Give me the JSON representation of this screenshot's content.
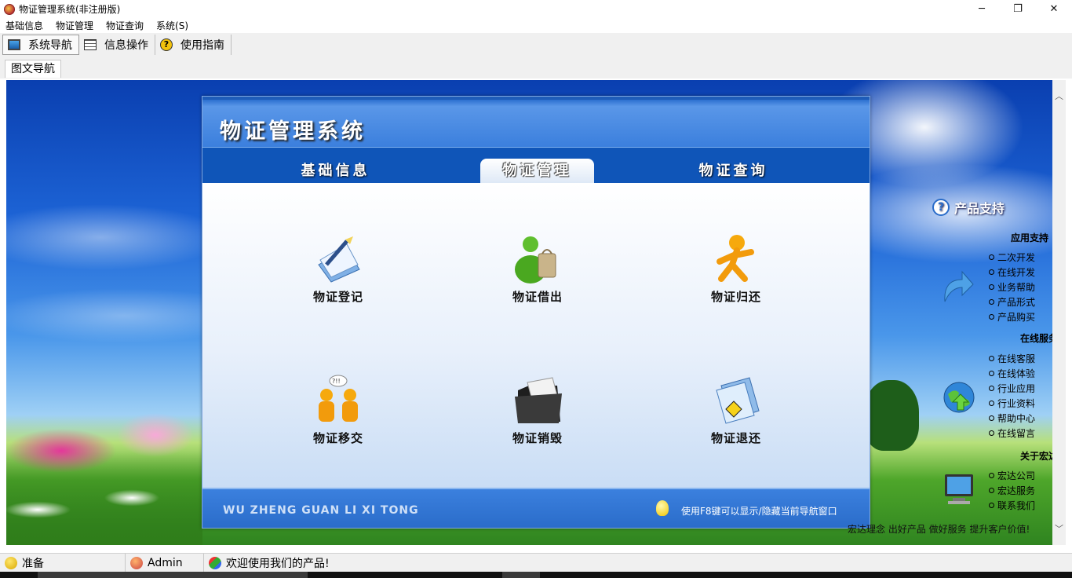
{
  "window": {
    "title": "物证管理系统(非注册版)",
    "minimize": "─",
    "maximize": "❐",
    "close": "✕"
  },
  "menu": [
    "基础信息",
    "物证管理",
    "物证查询",
    "系统(S)"
  ],
  "toolbar": {
    "nav": "系统导航",
    "info_op": "信息操作",
    "guide": "使用指南"
  },
  "doc_tab": "图文导航",
  "panel": {
    "title": "物证管理系统",
    "tabs": [
      "基础信息",
      "物证管理",
      "物证查询"
    ],
    "active_tab": "物证管理",
    "functions": [
      "物证登记",
      "物证借出",
      "物证归还",
      "物证移交",
      "物证销毁",
      "物证退还"
    ],
    "footer_left": "WU ZHENG GUAN LI XI TONG",
    "footer_tip": "使用F8键可以显示/隐藏当前导航窗口"
  },
  "support": {
    "title": "产品支持",
    "sections": [
      {
        "title": "应用支持",
        "items": [
          "二次开发",
          "在线开发",
          "业务帮助",
          "产品形式",
          "产品购买"
        ]
      },
      {
        "title": "在线服务",
        "items": [
          "在线客服",
          "在线体验",
          "行业应用",
          "行业资料",
          "帮助中心",
          "在线留言"
        ]
      },
      {
        "title": "关于宏达",
        "items": [
          "宏达公司",
          "宏达服务",
          "联系我们"
        ]
      }
    ],
    "slogan": "宏达理念 出好产品 做好服务 提升客户价值!"
  },
  "status": {
    "state": "准备",
    "user": "Admin",
    "welcome": "欢迎使用我们的产品!"
  },
  "colors": {
    "panel_blue": "#2a6cc9",
    "tab_dark": "#0f55b8",
    "accent_orange": "#f29b0c"
  }
}
